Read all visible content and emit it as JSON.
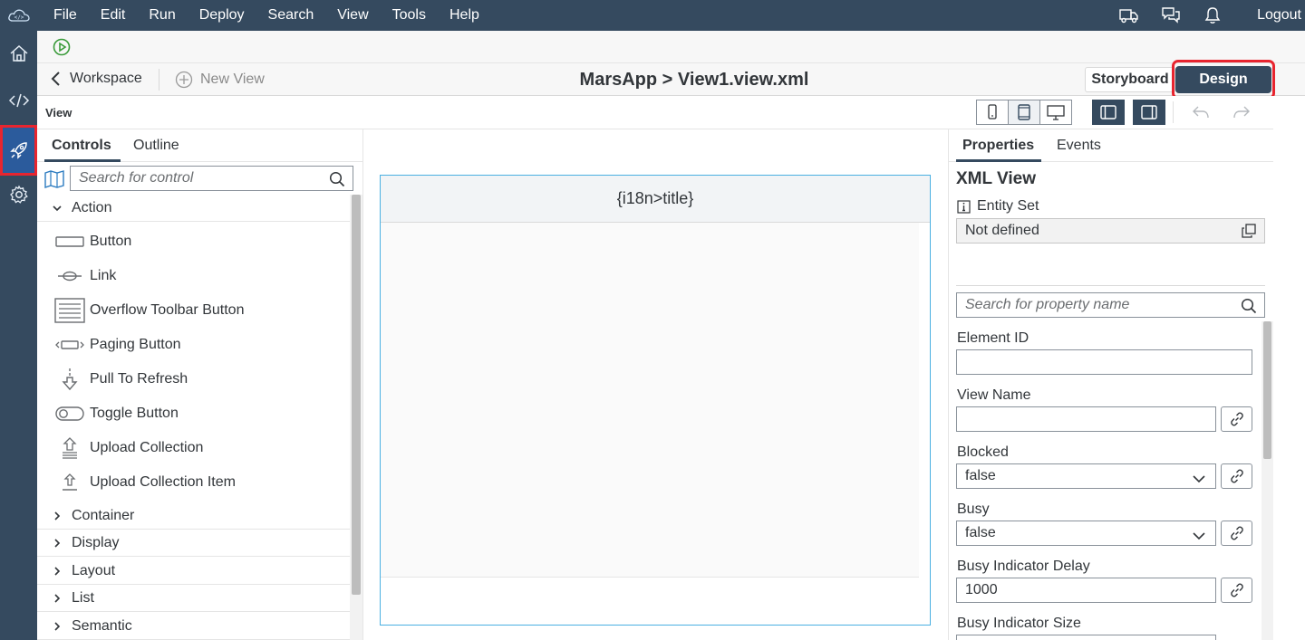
{
  "menubar": {
    "items": [
      "File",
      "Edit",
      "Run",
      "Deploy",
      "Search",
      "View",
      "Tools",
      "Help"
    ],
    "logout": "Logout"
  },
  "header": {
    "back_label": "Workspace",
    "new_view_label": "New View",
    "title": "MarsApp > View1.view.xml",
    "storyboard_label": "Storyboard",
    "design_label": "Design"
  },
  "viewbar": {
    "label": "View"
  },
  "left_panel": {
    "tabs": [
      "Controls",
      "Outline"
    ],
    "search_placeholder": "Search for control",
    "expanded_group": "Action",
    "controls": [
      "Button",
      "Link",
      "Overflow Toolbar Button",
      "Paging Button",
      "Pull To Refresh",
      "Toggle Button",
      "Upload Collection",
      "Upload Collection Item"
    ],
    "groups": [
      "Container",
      "Display",
      "Layout",
      "List",
      "Semantic"
    ]
  },
  "canvas": {
    "page_title": "{i18n>title}"
  },
  "right_panel": {
    "tabs": [
      "Properties",
      "Events"
    ],
    "section_title": "XML View",
    "entity_set_label": "Entity Set",
    "entity_set_value": "Not defined",
    "search_placeholder": "Search for property name",
    "properties": {
      "element_id_label": "Element ID",
      "element_id_value": "",
      "view_name_label": "View Name",
      "view_name_value": "",
      "blocked_label": "Blocked",
      "blocked_value": "false",
      "busy_label": "Busy",
      "busy_value": "false",
      "busy_delay_label": "Busy Indicator Delay",
      "busy_delay_value": "1000",
      "busy_size_label": "Busy Indicator Size"
    }
  },
  "colors": {
    "shell": "#354a5f",
    "highlight": "#e8252f",
    "canvas_border": "#4ab0e2",
    "run_green": "#3a9b3a"
  }
}
